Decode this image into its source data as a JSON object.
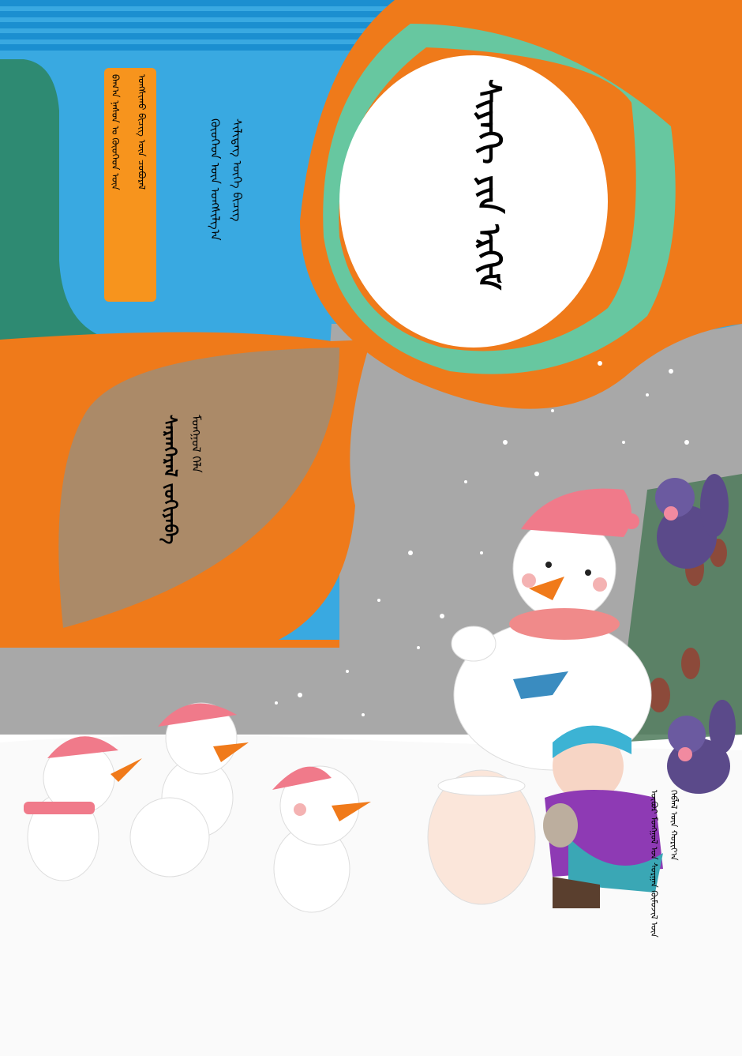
{
  "book": {
    "title": "ᠰᠢᠶᠠᠬᠢ ᠶᠢᠨ ᠡᠷᠬᠢᠮ",
    "series": [
      "ᠬᠦᠦᠬᠡᠳ ᠦᠨ ᠤᠩᠱᠢᠯᠭ᠎ᠠ",
      "ᠰᠢᠯᠢᠳᠡᠭ ᠦᠭᠡ ᠪᠢᠴᠢᠭ"
    ],
    "badge": [
      "ᠪᠠᠭ᠎ᠠ ᠨᠠᠰᠤᠨ ᠤ ᠬᠦᠦᠬᠡᠳ ᠦᠨ",
      "ᠤᠩᠱᠢᠬᠤ ᠪᠢᠴᠢᠭ ᠦᠨ ᠴᠤᠪᠤᠷᠠᠯ"
    ],
    "author": [
      "ᠰᠠᠷᠠᠨᠭᠡᠷᠡᠯ ᠵᠣᠬᠢᠶᠠᠪᠠ",
      "ᠮᠣᠩᠭᠣᠯ ᠬᠡᠯᠡ"
    ],
    "publisher": [
      "ᠦᠪᠦᠷ ᠮᠣᠩᠭᠣᠯ ᠤᠨ ᠰᠤᠷᠭᠠᠨ ᠬᠦᠮᠦᠵᠢᠯ ᠦᠨ",
      "ᠬᠡᠪᠯᠡᠯ ᠦᠨ ᠬᠣᠷᠢᠶ᠎ᠠ"
    ]
  },
  "colors": {
    "sky": "#39a9e1",
    "orange": "#ef7a1a",
    "teal": "#2e8a72",
    "mint": "#67c7a0",
    "tan": "#ab8a68",
    "gray": "#a8a8a8",
    "snow": "#ffffff",
    "badge": "#f7941d"
  },
  "illustration": {
    "subjects": [
      "snowman-large",
      "snowman-small",
      "snowman-small",
      "snowman-small",
      "snowball",
      "child",
      "squirrel",
      "squirrel",
      "pine-tree"
    ]
  }
}
